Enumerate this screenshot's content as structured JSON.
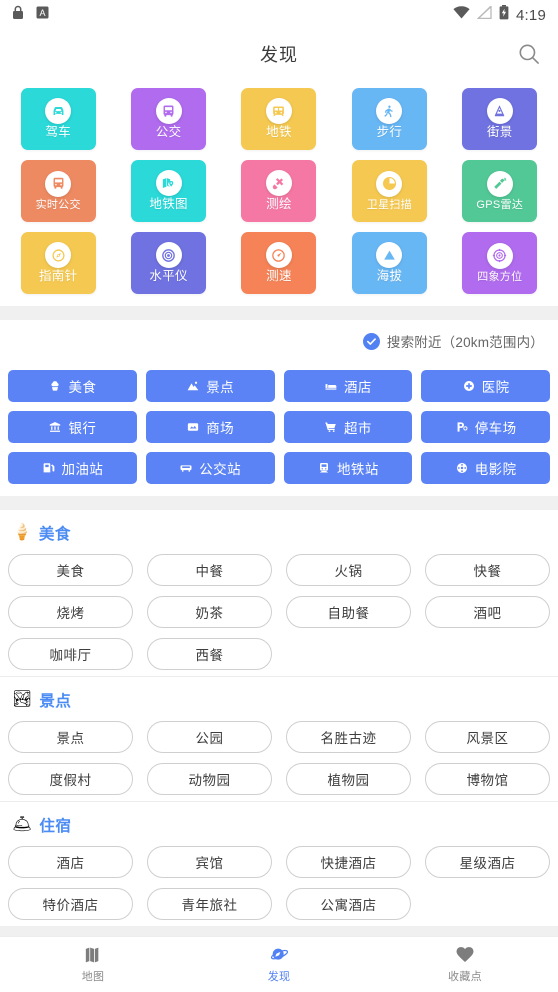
{
  "statusbar": {
    "time": "4:19",
    "icons": [
      "lock-icon",
      "a-badge-icon",
      "wifi-icon",
      "signal-icon",
      "battery-charging-icon"
    ]
  },
  "header": {
    "title": "发现",
    "search_icon": "search-icon"
  },
  "tiles": [
    {
      "label": "驾车",
      "color": "#2bd9d9",
      "icon": "car-icon"
    },
    {
      "label": "公交",
      "color": "#b06bee",
      "icon": "bus-icon"
    },
    {
      "label": "地铁",
      "color": "#f5c951",
      "icon": "subway-icon"
    },
    {
      "label": "步行",
      "color": "#68b7f5",
      "icon": "walk-icon"
    },
    {
      "label": "街景",
      "color": "#6f72e0",
      "icon": "street-view-icon"
    },
    {
      "label": "实时公交",
      "color": "#ee8a62",
      "icon": "realtime-bus-icon"
    },
    {
      "label": "地铁图",
      "color": "#2bd9d9",
      "icon": "metro-map-icon"
    },
    {
      "label": "测绘",
      "color": "#f578a4",
      "icon": "survey-icon"
    },
    {
      "label": "卫星扫描",
      "color": "#f5c951",
      "icon": "satellite-scan-icon"
    },
    {
      "label": "GPS雷达",
      "color": "#52c896",
      "icon": "gps-radar-icon"
    },
    {
      "label": "指南针",
      "color": "#f5c951",
      "icon": "compass-icon"
    },
    {
      "label": "水平仪",
      "color": "#6f72e0",
      "icon": "level-icon"
    },
    {
      "label": "测速",
      "color": "#f58357",
      "icon": "speedometer-icon"
    },
    {
      "label": "海拔",
      "color": "#68b7f5",
      "icon": "altitude-icon"
    },
    {
      "label": "四象方位",
      "color": "#b06bee",
      "icon": "quadrant-icon"
    }
  ],
  "nearby": {
    "label": "搜索附近（20km范围内）",
    "checked": true,
    "check_icon": "check-icon",
    "accent": "#5281f3"
  },
  "quick_buttons": [
    {
      "label": "美食",
      "icon": "cupcake-icon"
    },
    {
      "label": "景点",
      "icon": "mountain-icon"
    },
    {
      "label": "酒店",
      "icon": "bed-icon"
    },
    {
      "label": "医院",
      "icon": "hospital-cross-icon"
    },
    {
      "label": "银行",
      "icon": "bank-icon"
    },
    {
      "label": "商场",
      "icon": "mall-icon"
    },
    {
      "label": "超市",
      "icon": "shopping-cart-icon"
    },
    {
      "label": "停车场",
      "icon": "parking-icon"
    },
    {
      "label": "加油站",
      "icon": "fuel-pump-icon"
    },
    {
      "label": "公交站",
      "icon": "bus-stop-icon"
    },
    {
      "label": "地铁站",
      "icon": "subway-station-icon"
    },
    {
      "label": "电影院",
      "icon": "film-reel-icon"
    }
  ],
  "quick_button_color": "#5b83f5",
  "sections": [
    {
      "title": "美食",
      "emoji": "🍦",
      "chips": [
        "美食",
        "中餐",
        "火锅",
        "快餐",
        "烧烤",
        "奶茶",
        "自助餐",
        "酒吧",
        "咖啡厅",
        "西餐"
      ]
    },
    {
      "title": "景点",
      "emoji": "🏞",
      "chips": [
        "景点",
        "公园",
        "名胜古迹",
        "风景区",
        "度假村",
        "动物园",
        "植物园",
        "博物馆"
      ]
    },
    {
      "title": "住宿",
      "emoji": "🛎",
      "chips": [
        "酒店",
        "宾馆",
        "快捷酒店",
        "星级酒店",
        "特价酒店",
        "青年旅社",
        "公寓酒店"
      ]
    }
  ],
  "section_title_color": "#4b8bf4",
  "bottomnav": {
    "active_index": 1,
    "items": [
      {
        "label": "地图",
        "icon": "map-icon"
      },
      {
        "label": "发现",
        "icon": "discover-planet-icon"
      },
      {
        "label": "收藏点",
        "icon": "heart-icon"
      }
    ]
  }
}
